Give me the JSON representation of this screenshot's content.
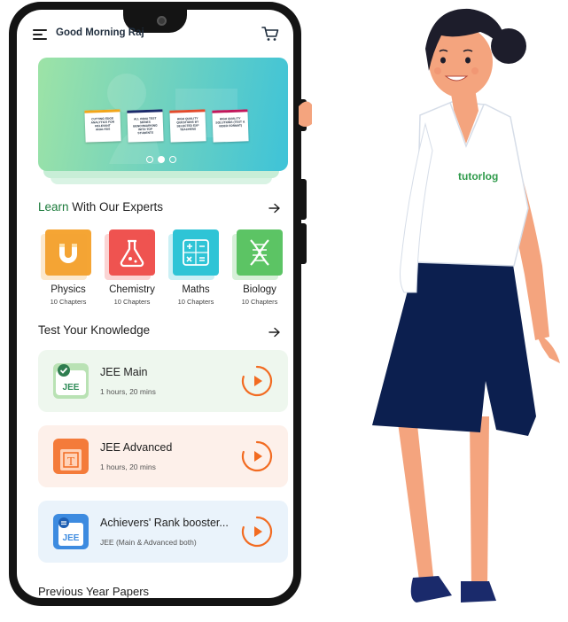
{
  "header": {
    "greeting": "Good Morning Raj"
  },
  "banner": {
    "cards": [
      "CUTTING EDGE ANALYTICS FOR RELEVANT ANALYSIS",
      "ALL INDIA TEST SERIES BENCHMARKING WITH TOP STUDENTS",
      "HIGH QUALITY QUESTIONS BY SELECTED EXP TEACHERS",
      "HIGH QUALITY SOLUTIONS (TEXT & VIDEO FORMAT)"
    ],
    "active_slide": 2,
    "slide_count": 3
  },
  "learn": {
    "title_accent": "Learn",
    "title_rest": " With Our Experts",
    "subjects": [
      {
        "name": "Physics",
        "chapters": "10 Chapters",
        "icon": "magnet-icon",
        "color": "#f5a534"
      },
      {
        "name": "Chemistry",
        "chapters": "10 Chapters",
        "icon": "flask-icon",
        "color": "#ef5350"
      },
      {
        "name": "Maths",
        "chapters": "10 Chapters",
        "icon": "math-symbols-icon",
        "color": "#2ec4d6"
      },
      {
        "name": "Biology",
        "chapters": "10 Chapters",
        "icon": "dna-icon",
        "color": "#5cc465"
      }
    ]
  },
  "tests": {
    "title": "Test Your Knowledge",
    "items": [
      {
        "title": "JEE Main",
        "meta": "1 hours, 20 mins",
        "bg": "#eef7ee",
        "badge": "JEE"
      },
      {
        "title": "JEE Advanced",
        "meta": "1 hours, 20 mins",
        "bg": "#fdf0ea",
        "badge": "T"
      },
      {
        "title": "Achievers' Rank booster...",
        "meta": "JEE (Main & Advanced both)",
        "bg": "#eaf3fb",
        "badge": "JEE"
      }
    ]
  },
  "next_section": {
    "title": "Previous Year Papers"
  },
  "brand": {
    "shirt_logo": "tutorlog"
  },
  "colors": {
    "accent_green": "#1b7a3a",
    "play_orange": "#f26b21"
  }
}
